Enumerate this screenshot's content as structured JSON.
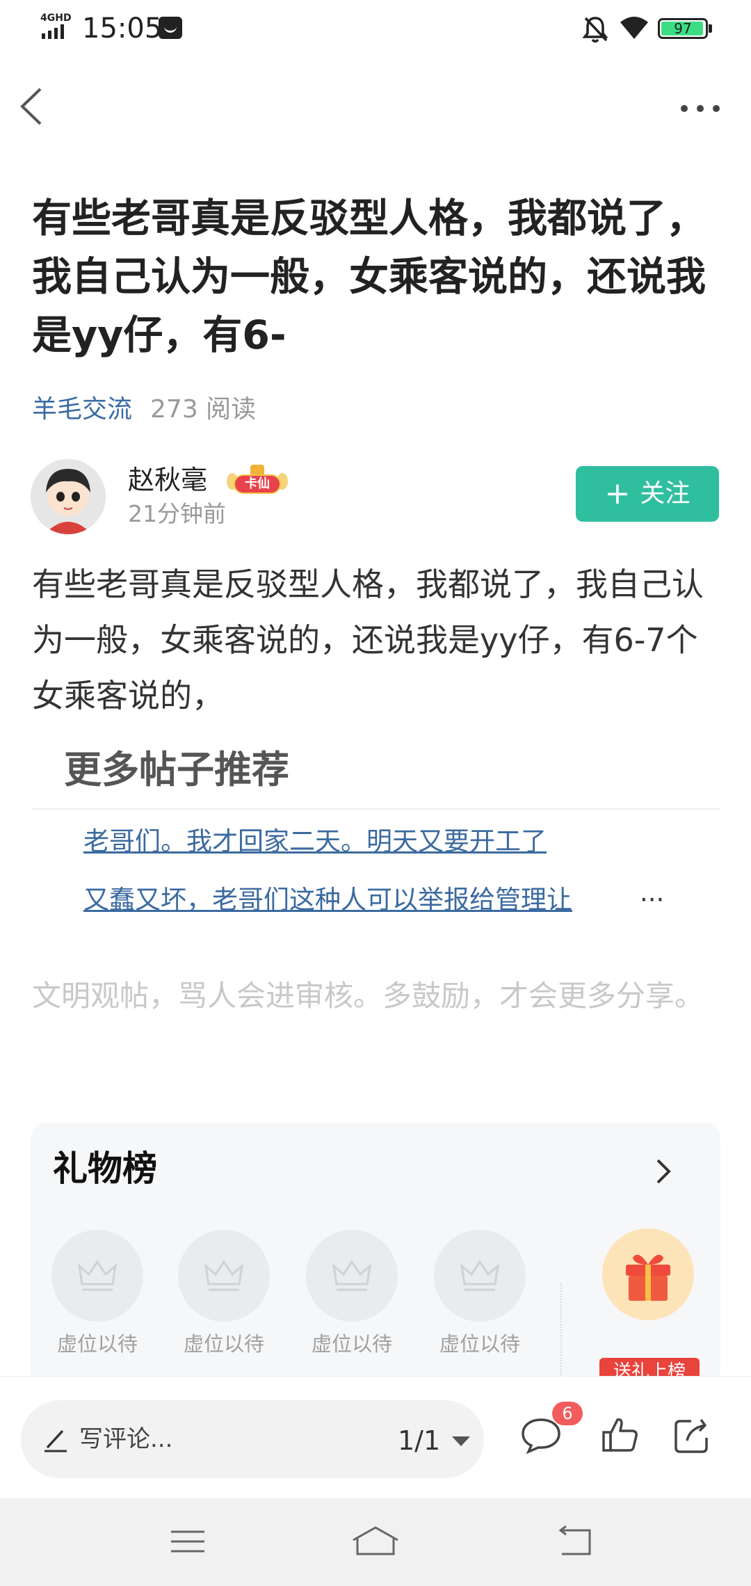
{
  "status_bar": {
    "network": "4GHD",
    "time": "15:05",
    "battery": "97",
    "battery_level": 0.97
  },
  "nav": {
    "back_icon": "chevron-left-icon",
    "more_icon": "more-dots-icon"
  },
  "post": {
    "title": "有些老哥真是反驳型人格，我都说了，我自己认为一般，女乘客说的，还说我是yy仔，有6-",
    "category": "羊毛交流",
    "reads": "273 阅读",
    "author": {
      "name": "赵秋毫",
      "badge": "卡仙",
      "time": "21分钟前",
      "follow_plus": "+",
      "follow_label": "关注"
    },
    "body": "有些老哥真是反驳型人格，我都说了，我自己认为一般，女乘客说的，还说我是yy仔，有6-7个女乘客说的，"
  },
  "recommend": {
    "title": "更多帖子推荐",
    "items": [
      "老哥们。我才回家二天。明天又要开工了",
      "又蠢又坏，老哥们这种人可以举报给管理让"
    ],
    "ellipsis": "···"
  },
  "civil_notice": "文明观帖，骂人会进审核。多鼓励，才会更多分享。",
  "gift_board": {
    "title": "礼物榜",
    "slots": [
      {
        "label": "虚位以待"
      },
      {
        "label": "虚位以待"
      },
      {
        "label": "虚位以待"
      },
      {
        "label": "虚位以待"
      }
    ],
    "send_label": "送礼上榜"
  },
  "bottom_bar": {
    "comment_placeholder": "写评论...",
    "page_indicator": "1/1",
    "comment_count": "6"
  },
  "colors": {
    "accent": "#2fbf9f",
    "link": "#3b6aa0",
    "badge_red": "#f25c5c"
  }
}
